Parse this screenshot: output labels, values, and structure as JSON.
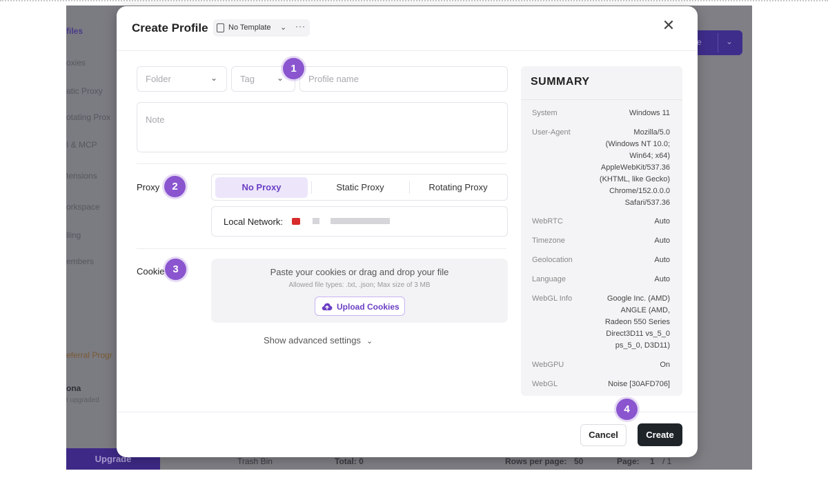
{
  "background_app": {
    "sidebar": {
      "items": [
        "files",
        "oxies",
        "atic Proxy",
        "otating Prox",
        "I & MCP",
        "tensions",
        "orkspace",
        "lling",
        "embers"
      ],
      "referral": "eferral Progr",
      "user_name": "ona",
      "user_status": "t upgraded",
      "upgrade_label": "Upgrade"
    },
    "header_button_label": "e",
    "footer": {
      "trash_label": "Trash Bin",
      "total_label": "Total: 0",
      "rows_per_page_label": "Rows per page:",
      "rows_per_page_value": "50",
      "page_label": "Page:",
      "page_value": "1",
      "page_total": "/ 1"
    }
  },
  "modal": {
    "title": "Create Profile",
    "template": {
      "label": "No Template",
      "more": "···"
    },
    "close_icon": "close-icon",
    "fields": {
      "folder_placeholder": "Folder",
      "tag_placeholder": "Tag",
      "profile_name_placeholder": "Profile name",
      "note_placeholder": "Note"
    },
    "proxy": {
      "label": "Proxy",
      "tabs": [
        "No Proxy",
        "Static Proxy",
        "Rotating Proxy"
      ],
      "active_tab": "No Proxy",
      "local_network_label": "Local Network:"
    },
    "cookies": {
      "label": "Cookie",
      "drop_text": "Paste your cookies or drag and drop your file",
      "allowed_text": "Allowed file types: .txt, .json; Max size of 3 MB",
      "upload_label": "Upload Cookies"
    },
    "advanced_label": "Show advanced settings",
    "steps": [
      "1",
      "2",
      "3",
      "4"
    ],
    "summary": {
      "title": "SUMMARY",
      "rows": [
        {
          "key": "System",
          "value": "Windows 11"
        },
        {
          "key": "User-Agent",
          "value": "Mozilla/5.0\n(Windows NT 10.0;\nWin64; x64)\nAppleWebKit/537.36\n(KHTML, like Gecko)\nChrome/152.0.0.0\nSafari/537.36"
        },
        {
          "key": "WebRTC",
          "value": "Auto"
        },
        {
          "key": "Timezone",
          "value": "Auto"
        },
        {
          "key": "Geolocation",
          "value": "Auto"
        },
        {
          "key": "Language",
          "value": "Auto"
        },
        {
          "key": "WebGL Info",
          "value": "Google Inc. (AMD)\nANGLE (AMD,\nRadeon 550 Series\nDirect3D11 vs_5_0\nps_5_0, D3D11)"
        },
        {
          "key": "WebGPU",
          "value": "On"
        },
        {
          "key": "WebGL",
          "value": "Noise [30AFD706]"
        }
      ]
    },
    "buttons": {
      "cancel": "Cancel",
      "create": "Create"
    },
    "colors": {
      "accent": "#8a55cf",
      "active_tab_bg": "#ede6fb",
      "create_bg": "#1e2428"
    }
  }
}
